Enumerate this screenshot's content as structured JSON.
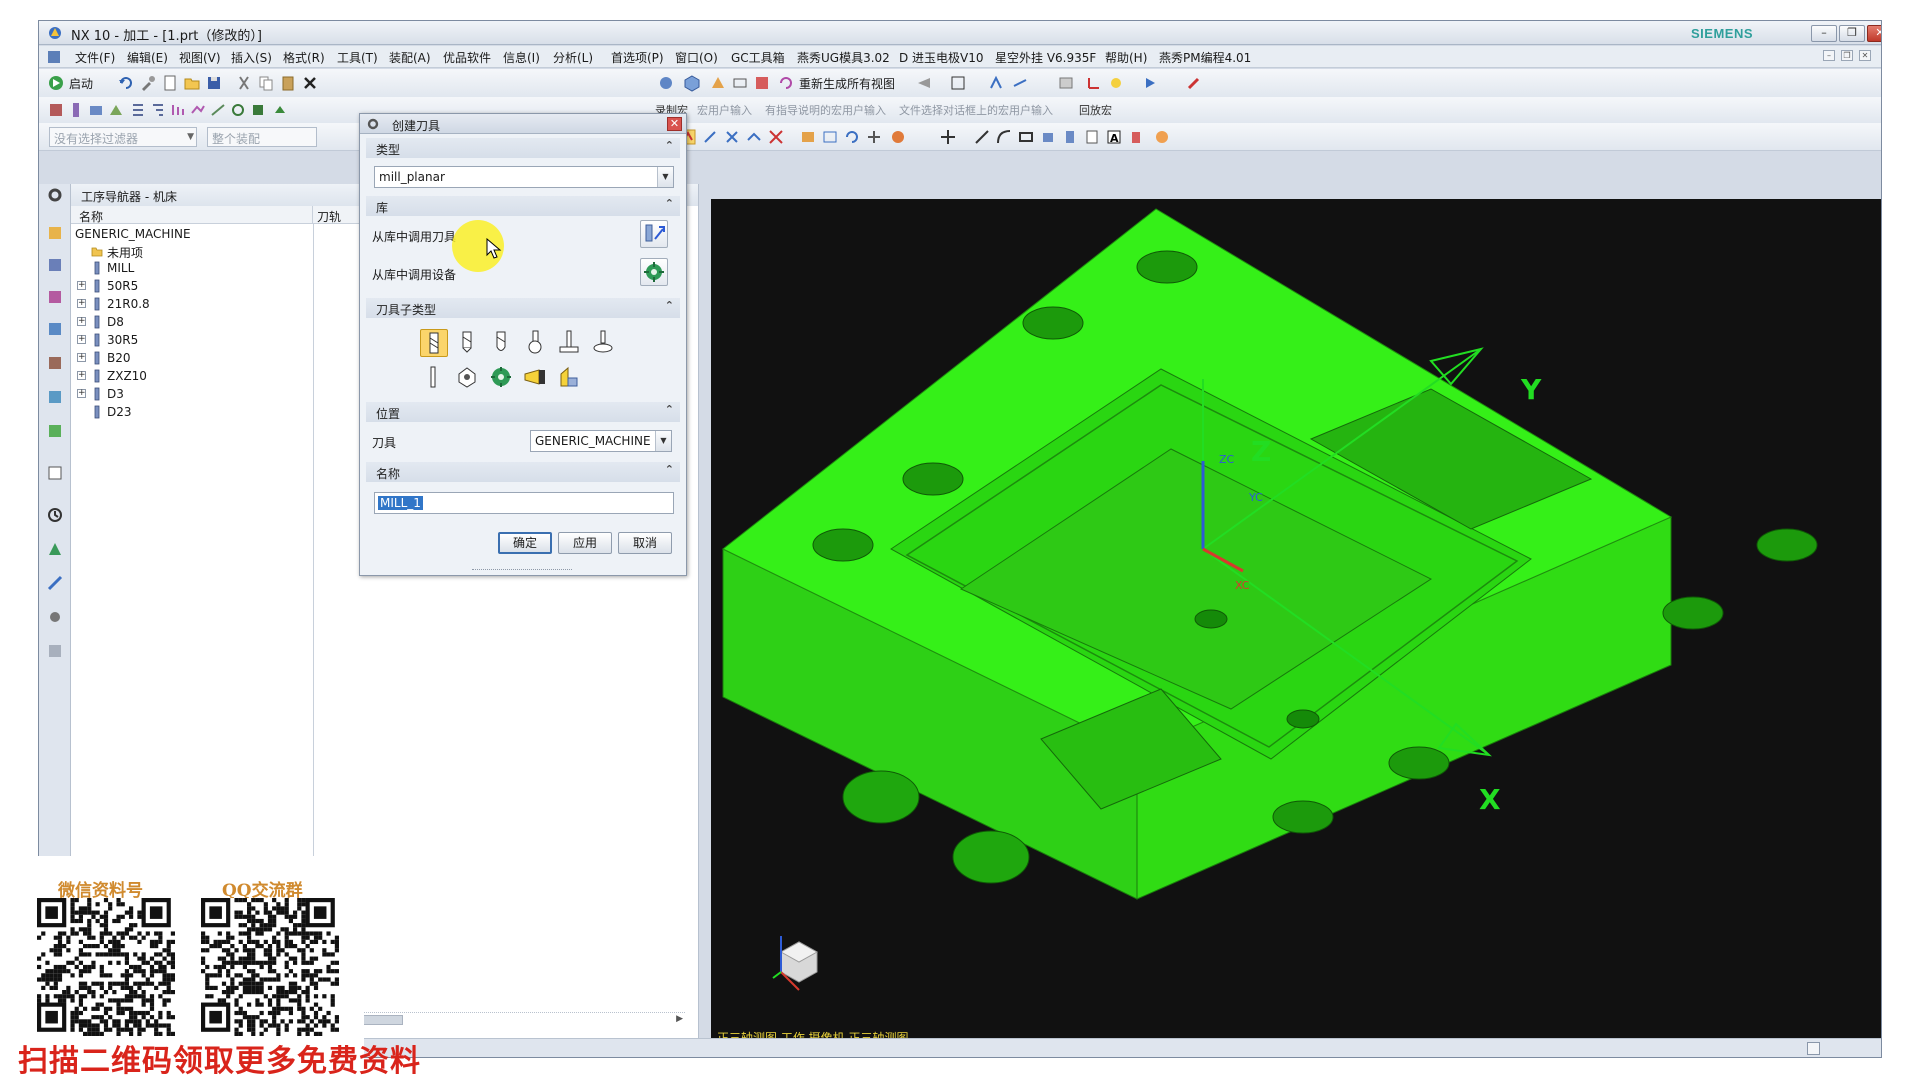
{
  "window": {
    "title": "NX 10 - 加工 - [1.prt（修改的）]",
    "brand": "SIEMENS",
    "controls": {
      "minimize": "–",
      "restore": "❐",
      "close": "✕"
    }
  },
  "menubar": {
    "items": [
      "文件(F)",
      "编辑(E)",
      "视图(V)",
      "插入(S)",
      "格式(R)",
      "工具(T)",
      "装配(A)",
      "优品软件",
      "信息(I)",
      "分析(L)",
      "首选项(P)",
      "窗口(O)",
      "GC工具箱",
      "燕秀UG模具3.02",
      "D 进玉电极V10",
      "星空外挂 V6.935F",
      "帮助(H)",
      "燕秀PM编程4.01"
    ],
    "mdi_controls": [
      "–",
      "❐",
      "✕"
    ]
  },
  "toolbar": {
    "start_label": "启动",
    "regen_label": "重新生成所有视图",
    "filter_placeholder": "没有选择过滤器",
    "assembly_placeholder": "整个装配",
    "macro": {
      "record": "录制宏",
      "user_input": "宏用户输入",
      "with_prompt": "有指导说明的宏用户输入",
      "file_dialog": "文件选择对话框上的宏用户输入",
      "playback": "回放宏"
    }
  },
  "navigator": {
    "title": "工序导航器 - 机床",
    "columns": [
      "名称",
      "刀轨"
    ],
    "root": "GENERIC_MACHINE",
    "unused": "未用项",
    "tools": [
      {
        "name": "MILL",
        "expandable": false
      },
      {
        "name": "50R5",
        "expandable": true
      },
      {
        "name": "21R0.8",
        "expandable": true
      },
      {
        "name": "D8",
        "expandable": true
      },
      {
        "name": "30R5",
        "expandable": true
      },
      {
        "name": "B20",
        "expandable": true
      },
      {
        "name": "ZXZ10",
        "expandable": true
      },
      {
        "name": "D3",
        "expandable": true
      },
      {
        "name": "D23",
        "expandable": false
      }
    ]
  },
  "dialog": {
    "title": "创建刀具",
    "close": "✕",
    "group_type": "类型",
    "type_value": "mill_planar",
    "group_library": "库",
    "retrieve_tool": "从库中调用刀具",
    "retrieve_device": "从库中调用设备",
    "group_subtype": "刀具子类型",
    "group_location": "位置",
    "tool_label": "刀具",
    "tool_value": "GENERIC_MACHINE",
    "group_name": "名称",
    "name_value": "MILL_1",
    "ok": "确定",
    "apply": "应用",
    "cancel": "取消",
    "collapse_glyph": "⌃"
  },
  "viewport": {
    "status": "正三轴测图 工作 摄像机 正三轴测图",
    "model_color": "#33ee11",
    "axis_color": "#22dd22",
    "axis_labels": {
      "x": "X",
      "y": "Y",
      "z": "Z",
      "xc": "XC",
      "yc": "YC",
      "zc": "ZC"
    }
  },
  "overlay": {
    "wechat_label": "微信资料号",
    "qq_label": "QQ交流群",
    "banner": "扫描二维码领取更多免费资料"
  }
}
